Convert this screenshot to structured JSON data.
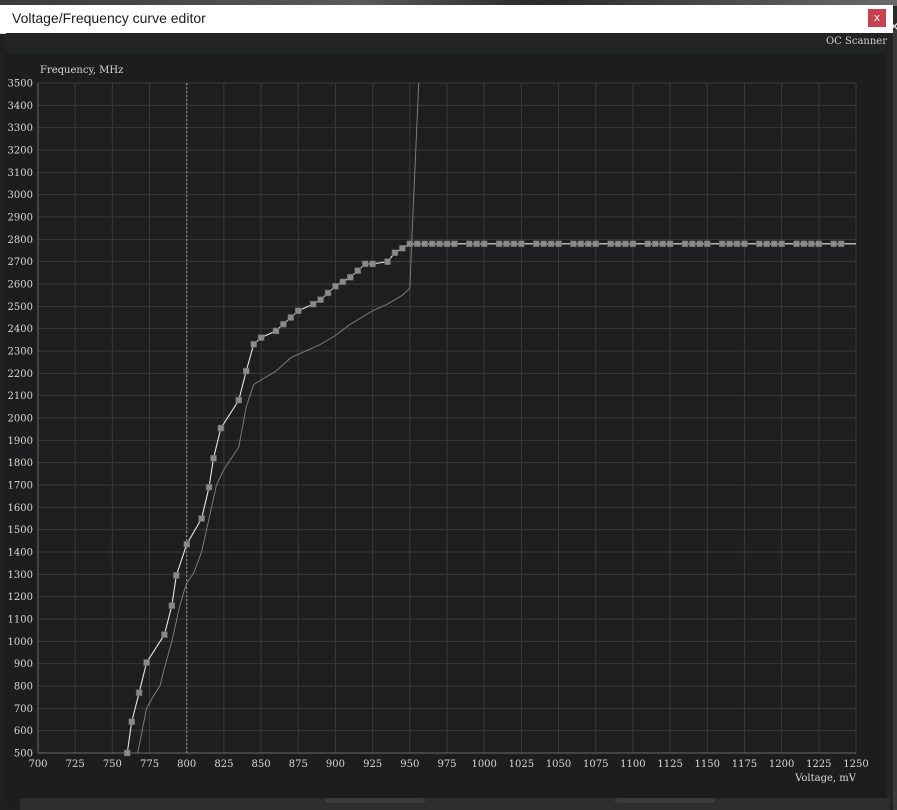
{
  "window": {
    "title": "Voltage/Frequency curve editor",
    "close_label": "x",
    "side_close_label": "✕",
    "oc_scanner_label": "OC Scanner"
  },
  "colors": {
    "background": "#1d1d1f",
    "grid": "#3a3a3c",
    "axis_text": "#d8d8d8",
    "curve": "#e6e6e6",
    "default_curve": "#7a7a7a",
    "point": "#8a8a8a",
    "close_button": "#c9414a"
  },
  "chart_data": {
    "type": "line",
    "ylabel": "Frequency, MHz",
    "xlabel": "Voltage, mV",
    "xlim": [
      700,
      1250
    ],
    "ylim": [
      500,
      3500
    ],
    "x_ticks": [
      700,
      725,
      750,
      775,
      800,
      825,
      850,
      875,
      900,
      925,
      950,
      975,
      1000,
      1025,
      1050,
      1075,
      1100,
      1125,
      1150,
      1175,
      1200,
      1225,
      1250
    ],
    "y_ticks": [
      500,
      600,
      700,
      800,
      900,
      1000,
      1100,
      1200,
      1300,
      1400,
      1500,
      1600,
      1700,
      1800,
      1900,
      2000,
      2100,
      2200,
      2300,
      2400,
      2500,
      2600,
      2700,
      2800,
      2900,
      3000,
      3100,
      3200,
      3300,
      3400,
      3500
    ],
    "grid": true,
    "marker_voltage": 800,
    "series": [
      {
        "role": "edited-curve-points",
        "x": [
          760,
          763,
          768,
          773,
          785,
          790,
          793,
          800,
          810,
          815,
          818,
          823,
          835,
          840,
          845,
          850,
          860,
          865,
          870,
          875,
          885,
          890,
          895,
          900,
          905,
          910,
          915,
          920,
          925,
          935,
          940,
          945,
          950,
          955,
          960,
          965,
          970,
          975,
          980,
          990,
          995,
          1000,
          1010,
          1015,
          1020,
          1025,
          1035,
          1040,
          1045,
          1050,
          1060,
          1065,
          1070,
          1075,
          1085,
          1090,
          1095,
          1100,
          1110,
          1115,
          1120,
          1125,
          1135,
          1140,
          1145,
          1150,
          1160,
          1165,
          1170,
          1175,
          1185,
          1190,
          1195,
          1200,
          1210,
          1215,
          1220,
          1225,
          1235,
          1240
        ],
        "y": [
          500,
          640,
          770,
          905,
          1030,
          1160,
          1295,
          1435,
          1550,
          1690,
          1820,
          1955,
          2080,
          2210,
          2330,
          2360,
          2390,
          2420,
          2450,
          2480,
          2510,
          2530,
          2560,
          2590,
          2610,
          2630,
          2660,
          2690,
          2690,
          2700,
          2740,
          2760,
          2780,
          2780,
          2780,
          2780,
          2780,
          2780,
          2780,
          2780,
          2780,
          2780,
          2780,
          2780,
          2780,
          2780,
          2780,
          2780,
          2780,
          2780,
          2780,
          2780,
          2780,
          2780,
          2780,
          2780,
          2780,
          2780,
          2780,
          2780,
          2780,
          2780,
          2780,
          2780,
          2780,
          2780,
          2780,
          2780,
          2780,
          2780,
          2780,
          2780,
          2780,
          2780,
          2780,
          2780,
          2780,
          2780,
          2780,
          2780
        ]
      },
      {
        "role": "default-curve",
        "x": [
          767,
          770,
          773,
          778,
          782,
          785,
          790,
          795,
          798,
          800,
          805,
          810,
          815,
          820,
          825,
          830,
          835,
          840,
          845,
          850,
          860,
          870,
          880,
          890,
          900,
          910,
          920,
          925,
          935,
          945,
          950,
          952,
          954,
          956
        ],
        "y": [
          500,
          600,
          700,
          760,
          800,
          880,
          1000,
          1150,
          1220,
          1260,
          1310,
          1400,
          1550,
          1700,
          1770,
          1820,
          1870,
          2050,
          2150,
          2170,
          2210,
          2270,
          2300,
          2330,
          2370,
          2420,
          2460,
          2480,
          2510,
          2550,
          2580,
          2900,
          3200,
          3500
        ]
      }
    ]
  }
}
